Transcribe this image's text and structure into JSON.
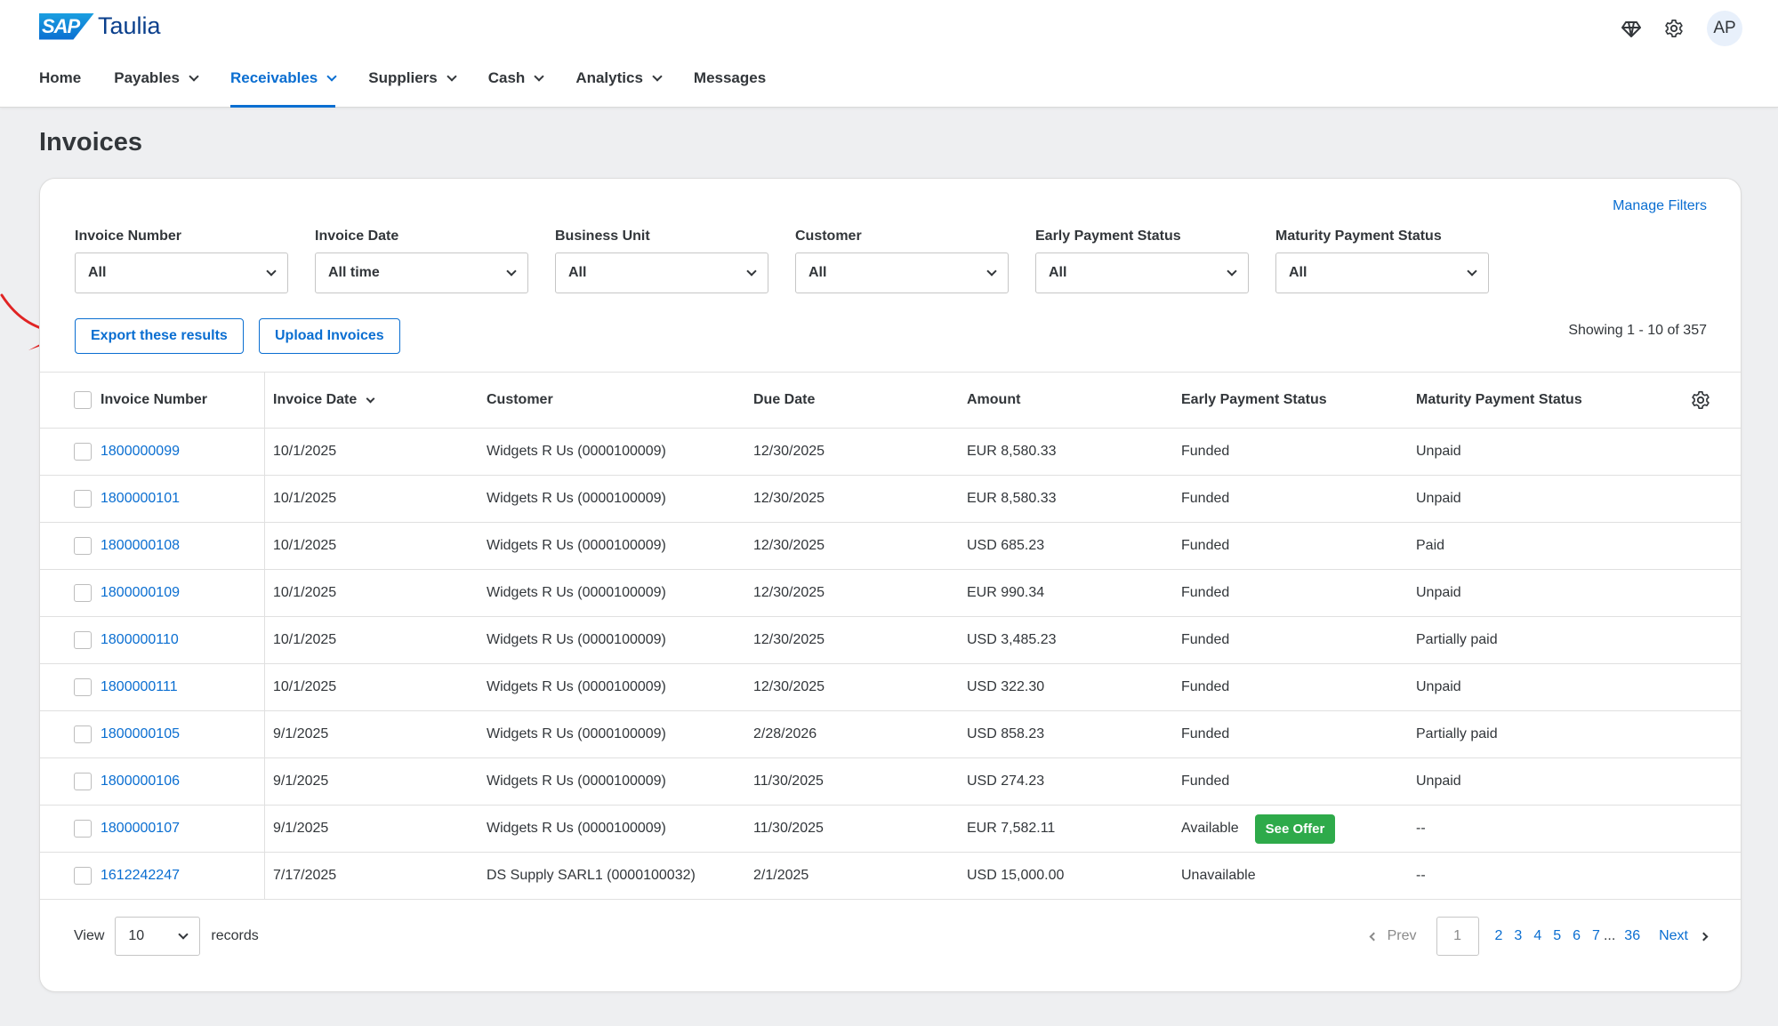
{
  "brand": {
    "sap": "SAP",
    "name": "Taulia"
  },
  "header": {
    "avatar": "AP"
  },
  "nav": [
    {
      "label": "Home",
      "dropdown": false
    },
    {
      "label": "Payables",
      "dropdown": true
    },
    {
      "label": "Receivables",
      "dropdown": true,
      "active": true
    },
    {
      "label": "Suppliers",
      "dropdown": true
    },
    {
      "label": "Cash",
      "dropdown": true
    },
    {
      "label": "Analytics",
      "dropdown": true
    },
    {
      "label": "Messages",
      "dropdown": false
    }
  ],
  "page_title": "Invoices",
  "manage_filters": "Manage Filters",
  "filters": [
    {
      "label": "Invoice Number",
      "value": "All"
    },
    {
      "label": "Invoice Date",
      "value": "All time"
    },
    {
      "label": "Business Unit",
      "value": "All"
    },
    {
      "label": "Customer",
      "value": "All"
    },
    {
      "label": "Early Payment Status",
      "value": "All"
    },
    {
      "label": "Maturity Payment Status",
      "value": "All"
    }
  ],
  "actions": {
    "export": "Export these results",
    "upload": "Upload Invoices"
  },
  "showing": "Showing 1 - 10 of 357",
  "table": {
    "columns": [
      "Invoice Number",
      "Invoice Date",
      "Customer",
      "Due Date",
      "Amount",
      "Early Payment Status",
      "Maturity Payment Status"
    ],
    "rows": [
      {
        "number": "1800000099",
        "date": "10/1/2025",
        "customer": "Widgets R Us (0000100009)",
        "due": "12/30/2025",
        "amount": "EUR 8,580.33",
        "early": "Funded",
        "maturity": "Unpaid"
      },
      {
        "number": "1800000101",
        "date": "10/1/2025",
        "customer": "Widgets R Us (0000100009)",
        "due": "12/30/2025",
        "amount": "EUR 8,580.33",
        "early": "Funded",
        "maturity": "Unpaid"
      },
      {
        "number": "1800000108",
        "date": "10/1/2025",
        "customer": "Widgets R Us (0000100009)",
        "due": "12/30/2025",
        "amount": "USD 685.23",
        "early": "Funded",
        "maturity": "Paid"
      },
      {
        "number": "1800000109",
        "date": "10/1/2025",
        "customer": "Widgets R Us (0000100009)",
        "due": "12/30/2025",
        "amount": "EUR 990.34",
        "early": "Funded",
        "maturity": "Unpaid"
      },
      {
        "number": "1800000110",
        "date": "10/1/2025",
        "customer": "Widgets R Us (0000100009)",
        "due": "12/30/2025",
        "amount": "USD 3,485.23",
        "early": "Funded",
        "maturity": "Partially paid"
      },
      {
        "number": "1800000111",
        "date": "10/1/2025",
        "customer": "Widgets R Us (0000100009)",
        "due": "12/30/2025",
        "amount": "USD 322.30",
        "early": "Funded",
        "maturity": "Unpaid"
      },
      {
        "number": "1800000105",
        "date": "9/1/2025",
        "customer": "Widgets R Us (0000100009)",
        "due": "2/28/2026",
        "amount": "USD 858.23",
        "early": "Funded",
        "maturity": "Partially paid"
      },
      {
        "number": "1800000106",
        "date": "9/1/2025",
        "customer": "Widgets R Us (0000100009)",
        "due": "11/30/2025",
        "amount": "USD 274.23",
        "early": "Funded",
        "maturity": "Unpaid"
      },
      {
        "number": "1800000107",
        "date": "9/1/2025",
        "customer": "Widgets R Us (0000100009)",
        "due": "11/30/2025",
        "amount": "EUR 7,582.11",
        "early": "Available",
        "offer": "See Offer",
        "maturity": "--"
      },
      {
        "number": "1612242247",
        "date": "7/17/2025",
        "customer": "DS Supply SARL1 (0000100032)",
        "due": "2/1/2025",
        "amount": "USD 15,000.00",
        "early": "Unavailable",
        "maturity": "--"
      }
    ]
  },
  "footer": {
    "view_label": "View",
    "page_size": "10",
    "records_label": "records",
    "prev": "Prev",
    "current_page": "1",
    "pages": [
      "2",
      "3",
      "4",
      "5",
      "6",
      "7"
    ],
    "ellipsis": "...",
    "last_page": "36",
    "next": "Next"
  },
  "colors": {
    "accent": "#0a6ed1",
    "offer": "#2eaa4a",
    "arrow": "#e02424"
  }
}
